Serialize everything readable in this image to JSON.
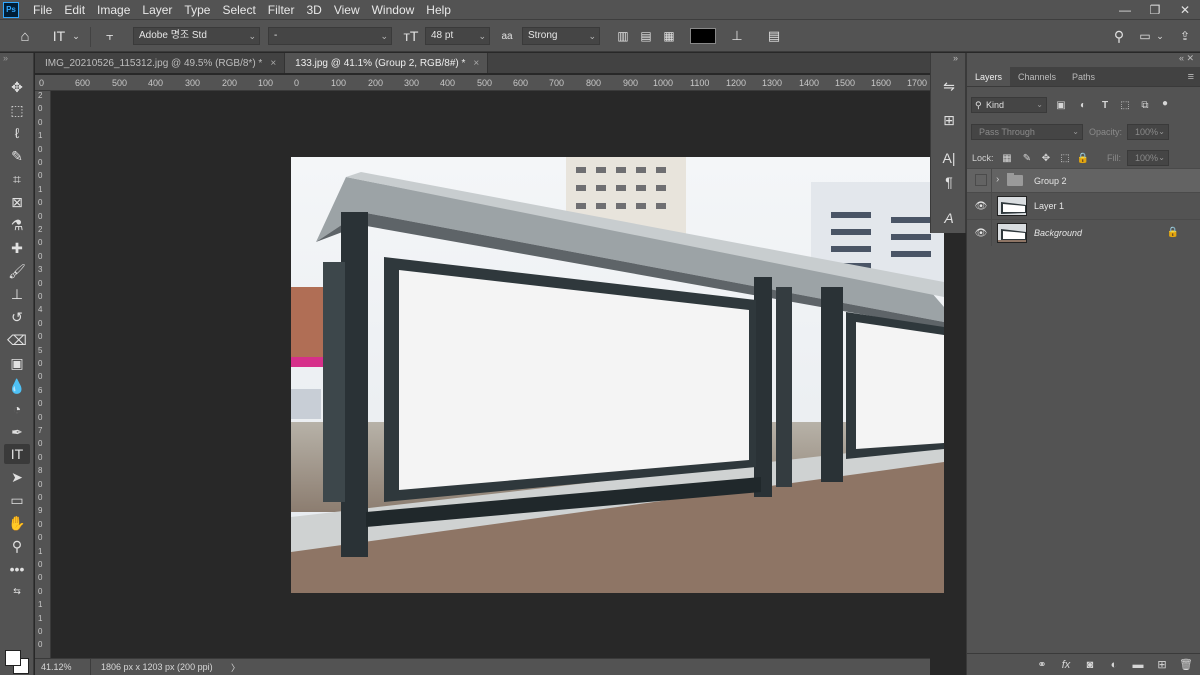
{
  "app": {
    "logo": "Ps"
  },
  "menu": [
    "File",
    "Edit",
    "Image",
    "Layer",
    "Type",
    "Select",
    "Filter",
    "3D",
    "View",
    "Window",
    "Help"
  ],
  "window_controls": [
    "minimize-icon",
    "restore-icon",
    "close-icon"
  ],
  "options_bar": {
    "font_family": "Adobe 명조 Std",
    "font_style": "-",
    "font_size": "48 pt",
    "antialias_label": "aa",
    "antialias": "Strong",
    "text_color": "#000000"
  },
  "tabs": [
    {
      "label": "IMG_20210526_115312.jpg @ 49.5% (RGB/8*) *",
      "active": false
    },
    {
      "label": "133.jpg @ 41.1% (Group 2, RGB/8#) *",
      "active": true
    }
  ],
  "tab_close": "×",
  "ruler_h": [
    "0",
    "600",
    "500",
    "400",
    "300",
    "200",
    "100",
    "0",
    "100",
    "200",
    "300",
    "400",
    "500",
    "600",
    "700",
    "800",
    "900",
    "1000",
    "1100",
    "1200",
    "1300",
    "1400",
    "1500",
    "1600",
    "1700"
  ],
  "ruler_v": [
    "2",
    "0",
    "0",
    "1",
    "0",
    "0",
    "0",
    "1",
    "0",
    "0",
    "2",
    "0",
    "0",
    "3",
    "0",
    "0",
    "4",
    "0",
    "0",
    "5",
    "0",
    "0",
    "6",
    "0",
    "0",
    "7",
    "0",
    "0",
    "8",
    "0",
    "0",
    "9",
    "0",
    "0",
    "1",
    "0",
    "0",
    "0",
    "1",
    "1",
    "0",
    "0"
  ],
  "status": {
    "zoom": "41.12%",
    "doc_info": "1806 px x 1203 px (200 ppi)",
    "arrow": "〉"
  },
  "panel": {
    "tabs": [
      "Layers",
      "Channels",
      "Paths"
    ],
    "filter_kind": "Kind",
    "blend_mode": "Pass Through",
    "opacity_label": "Opacity:",
    "opacity_value": "100%",
    "lock_label": "Lock:",
    "fill_label": "Fill:",
    "fill_value": "100%",
    "layers": [
      {
        "name": "Group 2",
        "type": "group",
        "visible": false
      },
      {
        "name": "Layer 1",
        "type": "pixel",
        "visible": true
      },
      {
        "name": "Background",
        "type": "background",
        "visible": true,
        "locked": true
      }
    ]
  },
  "colors": {
    "ui_bg": "#535353",
    "canvas_bg": "#282828",
    "accent": "#31a8ff"
  }
}
